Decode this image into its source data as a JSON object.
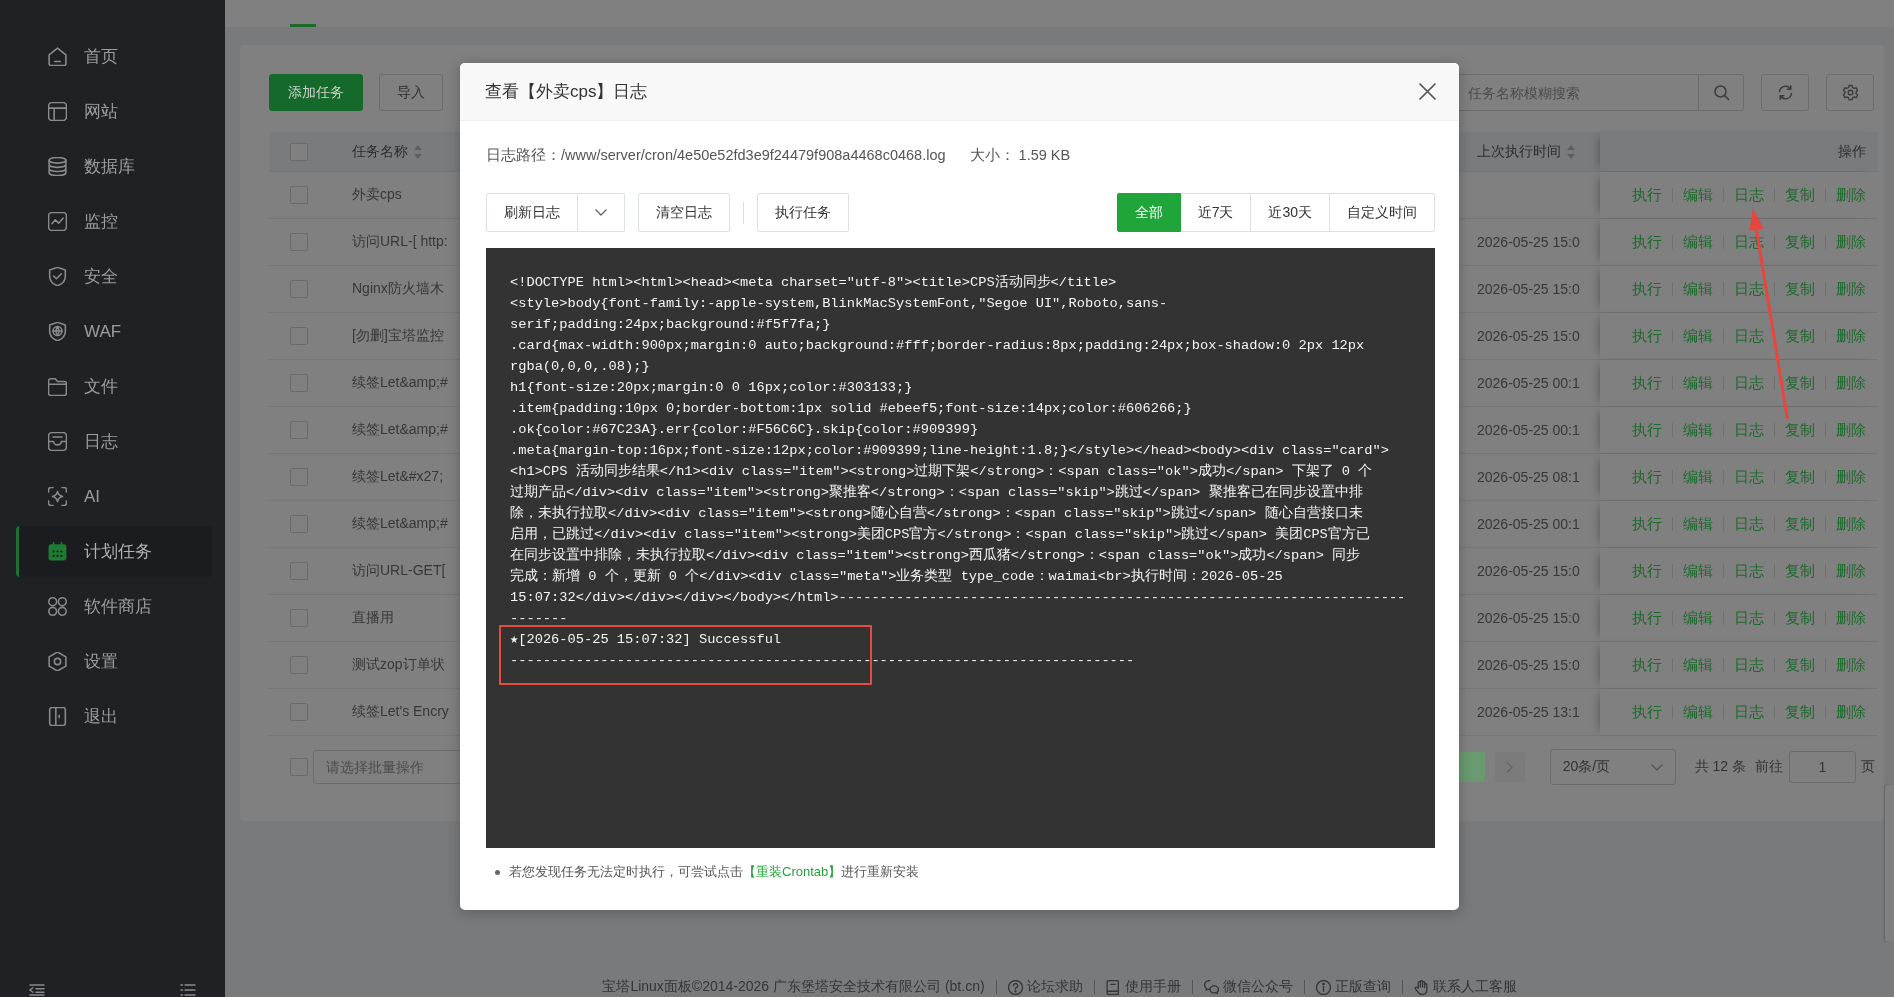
{
  "sidebar": {
    "items": [
      {
        "label": "首页",
        "selected": false
      },
      {
        "label": "网站",
        "selected": false
      },
      {
        "label": "数据库",
        "selected": false
      },
      {
        "label": "监控",
        "selected": false
      },
      {
        "label": "安全",
        "selected": false
      },
      {
        "label": "WAF",
        "selected": false
      },
      {
        "label": "文件",
        "selected": false
      },
      {
        "label": "日志",
        "selected": false
      },
      {
        "label": "AI",
        "selected": false
      },
      {
        "label": "计划任务",
        "selected": true
      },
      {
        "label": "软件商店",
        "selected": false
      },
      {
        "label": "设置",
        "selected": false
      },
      {
        "label": "退出",
        "selected": false
      }
    ]
  },
  "toolbar": {
    "buttons": [
      {
        "label": "添加任务",
        "kind": "primary"
      },
      {
        "label": "导入",
        "kind": "default"
      }
    ],
    "search": {
      "placeholder": "任务名称模糊搜索"
    }
  },
  "table": {
    "select_all": {
      "checked": false
    },
    "columns": [
      {
        "label": "任务名称",
        "sortable": true
      },
      {
        "label": "上次执行时间",
        "sortable": true
      },
      {
        "label": "操作",
        "sortable": false
      }
    ],
    "rows": [
      {
        "checked": false,
        "name": "外卖cps",
        "actions": [
          "执行",
          "编辑",
          "日志",
          "复制",
          "删除"
        ]
      },
      {
        "checked": false,
        "name": "访问URL-[ http:",
        "last_run": "2026-05-25 15:0",
        "actions": [
          "执行",
          "编辑",
          "日志",
          "复制",
          "删除"
        ]
      },
      {
        "checked": false,
        "name": "Nginx防火墙木",
        "last_run": "2026-05-25 15:0",
        "actions": [
          "执行",
          "编辑",
          "日志",
          "复制",
          "删除"
        ]
      },
      {
        "checked": false,
        "name": "[勿删]宝塔监控",
        "last_run": "2026-05-25 15:0",
        "actions": [
          "执行",
          "编辑",
          "日志",
          "复制",
          "删除"
        ]
      },
      {
        "checked": false,
        "name": "续签Let&amp;#",
        "last_run": "2026-05-25 00:1",
        "actions": [
          "执行",
          "编辑",
          "日志",
          "复制",
          "删除"
        ]
      },
      {
        "checked": false,
        "name": "续签Let&amp;#",
        "last_run": "2026-05-25 00:1",
        "actions": [
          "执行",
          "编辑",
          "日志",
          "复制",
          "删除"
        ]
      },
      {
        "checked": false,
        "name": "续签Let&#x27;",
        "last_run": "2026-05-25 08:1",
        "actions": [
          "执行",
          "编辑",
          "日志",
          "复制",
          "删除"
        ]
      },
      {
        "checked": false,
        "name": "续签Let&amp;#",
        "last_run": "2026-05-25 00:1",
        "actions": [
          "执行",
          "编辑",
          "日志",
          "复制",
          "删除"
        ]
      },
      {
        "checked": false,
        "name": "访问URL-GET[",
        "last_run": "2026-05-25 15:0",
        "actions": [
          "执行",
          "编辑",
          "日志",
          "复制",
          "删除"
        ]
      },
      {
        "checked": false,
        "name": "直播用",
        "last_run": "2026-05-25 15:0",
        "actions": [
          "执行",
          "编辑",
          "日志",
          "复制",
          "删除"
        ]
      },
      {
        "checked": false,
        "name": "测试zop订单状",
        "last_run": "2026-05-25 15:0",
        "actions": [
          "执行",
          "编辑",
          "日志",
          "复制",
          "删除"
        ]
      },
      {
        "checked": false,
        "name": "续签Let's Encry",
        "last_run": "2026-05-25 13:1",
        "actions": [
          "执行",
          "编辑",
          "日志",
          "复制",
          "删除"
        ]
      }
    ]
  },
  "pagination": {
    "select_all": {
      "checked": false
    },
    "batch": {
      "placeholder": "请选择批量操作"
    },
    "page_size": "20条/页",
    "total": "共 12 条",
    "goto_label": "前往",
    "goto_page": "1",
    "page_suffix": "页"
  },
  "footer": {
    "copyright": "宝塔Linux面板©2014-2026 广东堡塔安全技术有限公司 (bt.cn)",
    "links": [
      "论坛求助",
      "使用手册",
      "微信公众号",
      "正版查询",
      "联系人工客服"
    ]
  },
  "dialog": {
    "title": "查看【外卖cps】日志",
    "path": "日志路径：/www/server/cron/4e50e52fd3e9f24479f908a4468c0468.log",
    "size": "大小： 1.59 KB",
    "button_groups": [
      [
        {
          "label": "刷新日志",
          "kind": "split"
        },
        {
          "label": "清空日志",
          "kind": "plain"
        }
      ],
      [
        {
          "label": "执行任务",
          "kind": "plain"
        }
      ]
    ],
    "ranges": [
      {
        "label": "全部",
        "selected": true
      },
      {
        "label": "近7天",
        "selected": false
      },
      {
        "label": "近30天",
        "selected": false
      },
      {
        "label": "自定义时间",
        "selected": false
      }
    ],
    "log_lines": [
      "<!DOCTYPE html><html><head><meta charset=\"utf-8\"><title>CPS活动同步</title>",
      "<style>body{font-family:-apple-system,BlinkMacSystemFont,\"Segoe UI\",Roboto,sans-",
      "serif;padding:24px;background:#f5f7fa;}",
      ".card{max-width:900px;margin:0 auto;background:#fff;border-radius:8px;padding:24px;box-shadow:0 2px 12px",
      "rgba(0,0,0,.08);}",
      "h1{font-size:20px;margin:0 0 16px;color:#303133;}",
      ".item{padding:10px 0;border-bottom:1px solid #ebeef5;font-size:14px;color:#606266;}",
      ".ok{color:#67C23A}.err{color:#F56C6C}.skip{color:#909399}",
      ".meta{margin-top:16px;font-size:12px;color:#909399;line-height:1.8;}</style></head><body><div class=\"card\">",
      "<h1>CPS 活动同步结果</h1><div class=\"item\"><strong>过期下架</strong>：<span class=\"ok\">成功</span> 下架了 0 个",
      "过期产品</div><div class=\"item\"><strong>聚推客</strong>：<span class=\"skip\">跳过</span> 聚推客已在同步设置中排",
      "除，未执行拉取</div><div class=\"item\"><strong>随心自营</strong>：<span class=\"skip\">跳过</span> 随心自营接口未",
      "启用，已跳过</div><div class=\"item\"><strong>美团CPS官方</strong>：<span class=\"skip\">跳过</span> 美团CPS官方已",
      "在同步设置中排除，未执行拉取</div><div class=\"item\"><strong>西瓜猪</strong>：<span class=\"ok\">成功</span> 同步",
      "完成：新增 0 个，更新 0 个</div><div class=\"meta\">业务类型 type_code：waimai<br>执行时间：2026-05-25",
      "15:07:32</div></div></div></body></html>---------------------------------------------------------------------",
      "-------",
      "★[2026-05-25 15:07:32] Successful",
      "----------------------------------------------------------------------------"
    ],
    "tip": {
      "before": "若您发现任务无法定时执行，可尝试点击",
      "link": "【重装Crontab】",
      "after": "进行重新安装"
    }
  }
}
